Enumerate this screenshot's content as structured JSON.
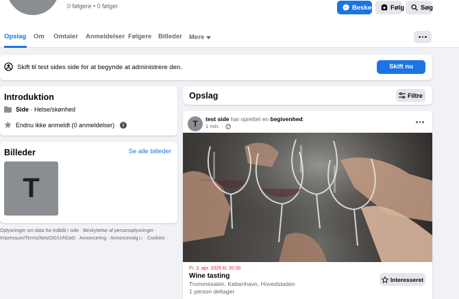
{
  "header": {
    "followers": "0 følgere • 0 følger",
    "buttons": {
      "message": "Besked",
      "follow": "Følg",
      "search": "Søg"
    }
  },
  "tabs": [
    "Opslag",
    "Om",
    "Omtaler",
    "Anmeldelser",
    "Følgere",
    "Billeder",
    "Mere"
  ],
  "switch_bar": {
    "text": "Skift til test sides side for at begynde at administrere den.",
    "button": "Skift nu"
  },
  "intro": {
    "title": "Introduktion",
    "category_label": "Side",
    "category_value": " · Helse/skønhed",
    "reviews": "Endnu ikke anmeldt (0 anmeldelser)"
  },
  "photos": {
    "title": "Billeder",
    "see_all": "Se alle billeder",
    "thumb_letter": "T"
  },
  "footer_links": "Oplysninger om data fra Indblik i side · Beskyttelse af personoplysninger · Impressum/Terms/NetzDG/UrhDaG · Annoncering · Annoncevalg ▷ · Cookies ·",
  "posts": {
    "title": "Opslag",
    "filter": "Filtre",
    "post": {
      "avatar_letter": "T",
      "author": "test side",
      "action": " har oprettet en ",
      "object": "begivenhed",
      "time": "1 min.",
      "event": {
        "date": "Fr. 3. apr. 2026 kl. 20.00",
        "title": "Wine tasting",
        "location": "Trommesalen, København, Hovedstaden",
        "attendees": "1 person deltager",
        "interested_button": "Interesseret"
      }
    }
  },
  "colors": {
    "accent": "#1b74e4",
    "event_date": "#e41e3f",
    "background": "#f0f2f5"
  }
}
